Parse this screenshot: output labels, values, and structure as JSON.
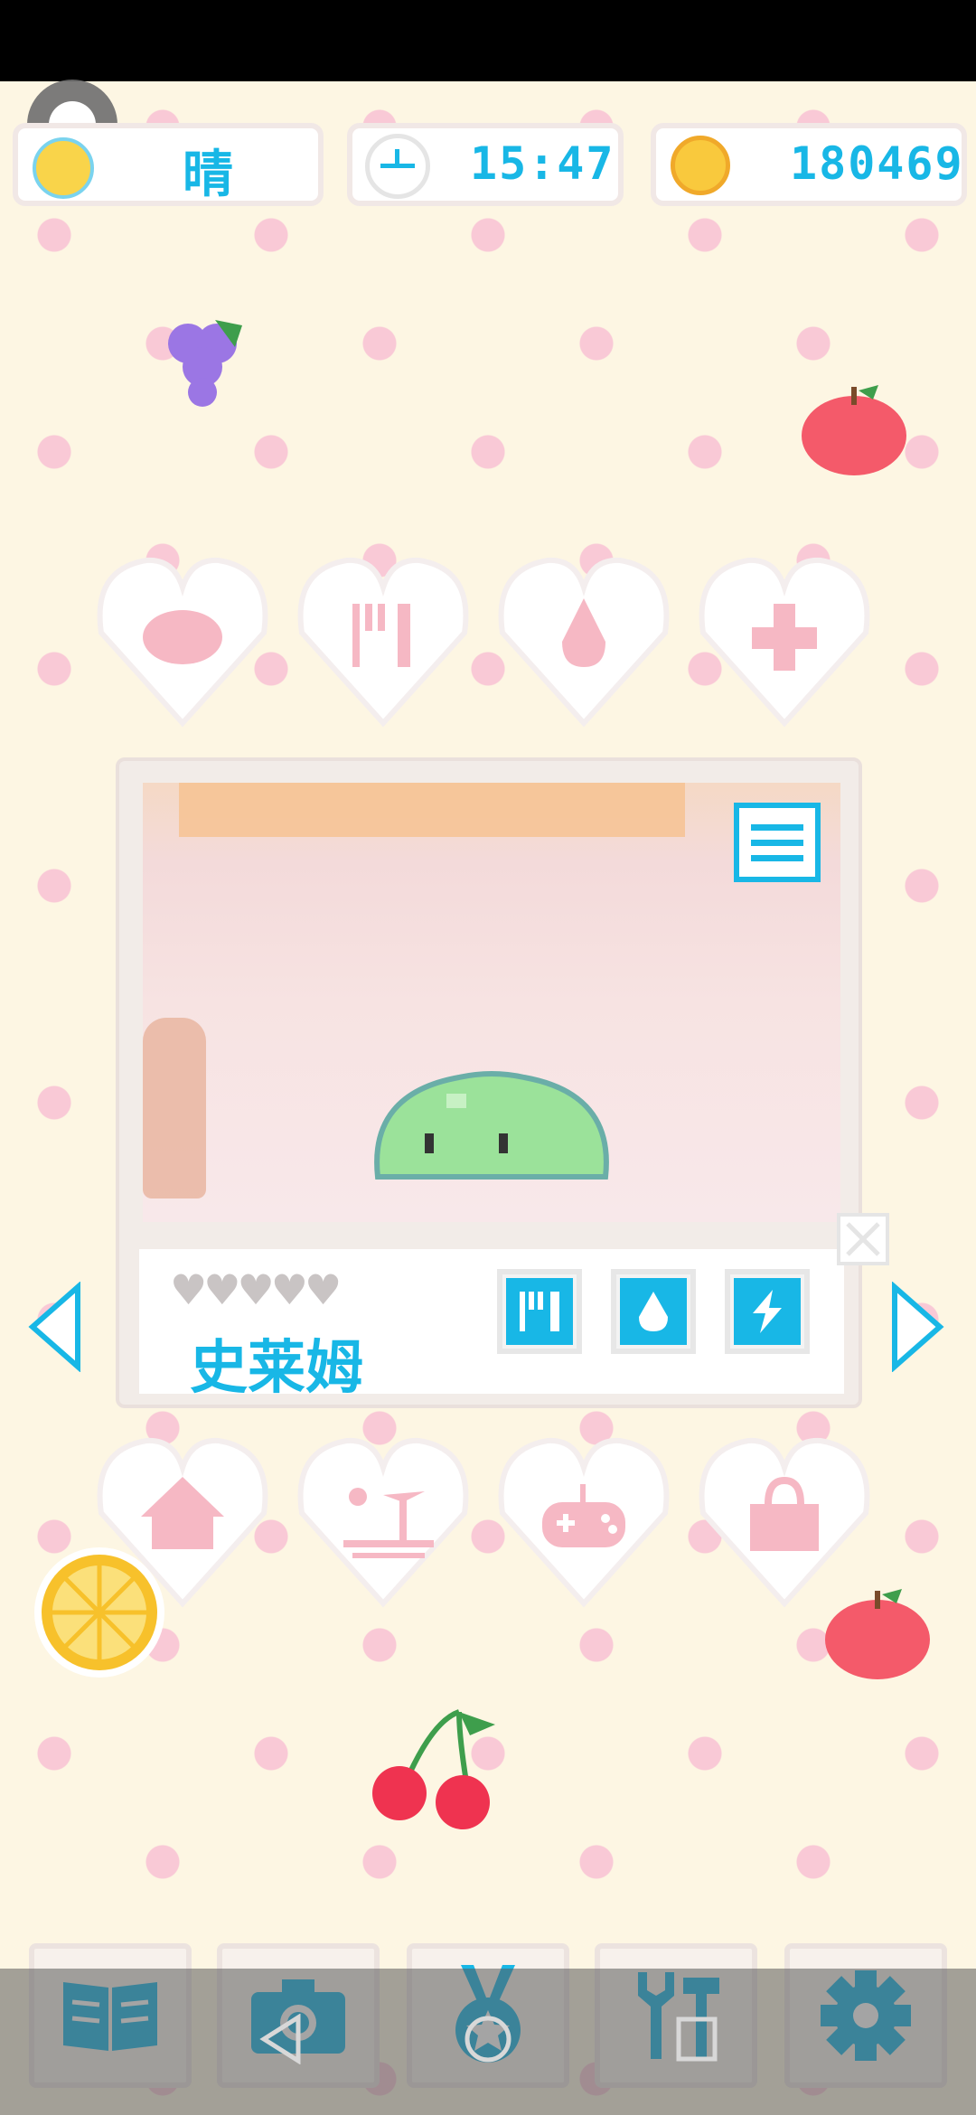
{
  "header": {
    "weather_label": "晴",
    "time_label": "15:47",
    "coins_label": "180469"
  },
  "pet": {
    "name": "史莱姆",
    "hearts": "♥♥♥♥♥",
    "hearts_filled": 0,
    "hearts_total": 5
  },
  "action_hearts": [
    "pet-face-icon",
    "fork-knife-icon",
    "water-drop-icon",
    "medical-cross-icon"
  ],
  "place_hearts": [
    "house-icon",
    "beach-island-icon",
    "gamepad-icon",
    "shopping-bag-icon"
  ],
  "stat_buttons": [
    "food-icon",
    "water-icon",
    "energy-icon"
  ],
  "bottom_toolbar": [
    "book-icon",
    "camera-icon",
    "medal-icon",
    "tools-icon",
    "settings-gear-icon"
  ],
  "colors": {
    "accent": "#18b7e6",
    "background": "#fdf6e3",
    "heart_icon": "#f6b8c4",
    "slime": "#9be29a"
  }
}
